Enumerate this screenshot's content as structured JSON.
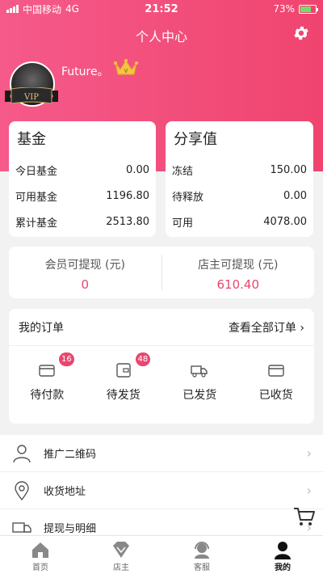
{
  "status_bar": {
    "carrier": "中国移动",
    "network": "4G",
    "time": "21:52",
    "battery": "73%",
    "battery_level": 0.73
  },
  "nav": {
    "title": "个人中心",
    "settings_icon": "gear-icon"
  },
  "profile": {
    "username": "Future。",
    "vip_text": "VIP",
    "crown_icon": "crown-icon",
    "crown_letter": "V"
  },
  "fund": {
    "title": "基金",
    "rows": [
      {
        "label": "今日基金",
        "value": "0.00"
      },
      {
        "label": "可用基金",
        "value": "1196.80"
      },
      {
        "label": "累计基金",
        "value": "2513.80"
      }
    ]
  },
  "share": {
    "title": "分享值",
    "rows": [
      {
        "label": "冻结",
        "value": "150.00"
      },
      {
        "label": "待释放",
        "value": "0.00"
      },
      {
        "label": "可用",
        "value": "4078.00"
      }
    ]
  },
  "withdraw": {
    "member_label": "会员可提现 (元)",
    "member_value": "0",
    "owner_label": "店主可提现 (元)",
    "owner_value": "610.40"
  },
  "orders": {
    "title": "我的订单",
    "view_all": "查看全部订单 ›",
    "items": [
      {
        "label": "待付款",
        "badge": "16",
        "icon": "wallet-icon"
      },
      {
        "label": "待发货",
        "badge": "48",
        "icon": "package-icon"
      },
      {
        "label": "已发货",
        "badge": "",
        "icon": "truck-icon"
      },
      {
        "label": "已收货",
        "badge": "",
        "icon": "box-icon"
      }
    ]
  },
  "menu": [
    {
      "label": "推广二维码",
      "icon": "user-icon"
    },
    {
      "label": "收货地址",
      "icon": "location-icon"
    },
    {
      "label": "提现与明细",
      "icon": "truck-icon"
    }
  ],
  "tabs": [
    {
      "label": "首页",
      "icon": "home-icon",
      "active": false
    },
    {
      "label": "店主",
      "icon": "diamond-icon",
      "active": false
    },
    {
      "label": "客服",
      "icon": "support-icon",
      "active": false
    },
    {
      "label": "我的",
      "icon": "profile-icon",
      "active": true
    }
  ],
  "colors": {
    "accent": "#f0446f",
    "badge": "#e8466f"
  }
}
